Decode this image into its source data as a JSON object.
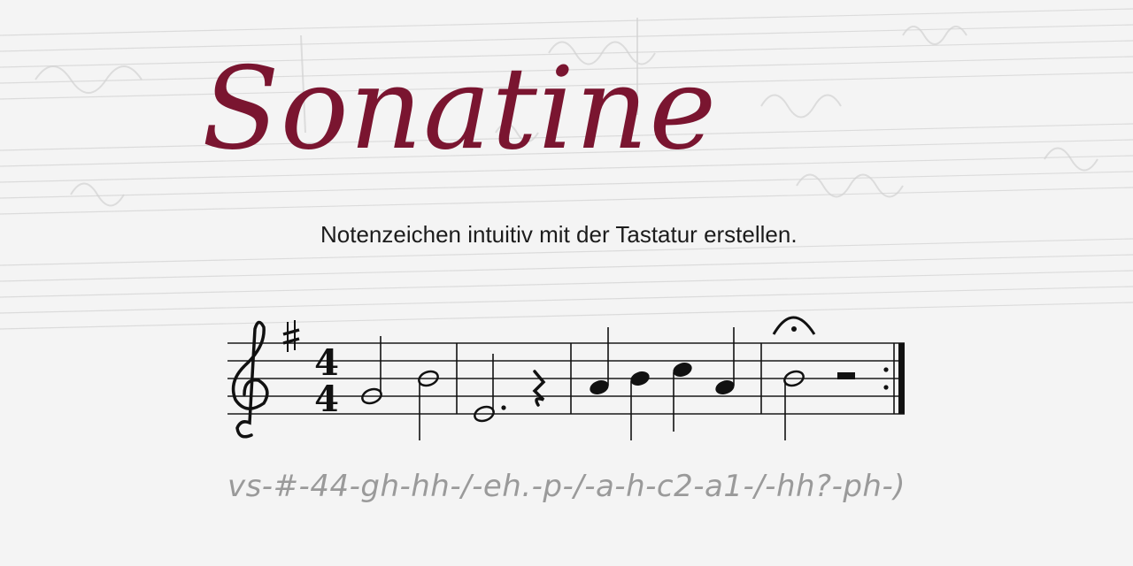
{
  "brand": {
    "title": "Sonatine",
    "title_color": "#7a1530",
    "tagline": "Notenzeichen intuitiv mit der Tastatur erstellen."
  },
  "notation": {
    "clef": "treble-clef",
    "key_signature": "#",
    "time_signature_top": "4",
    "time_signature_bottom": "4",
    "measures": [
      [
        "G half",
        "H half"
      ],
      [
        "E dotted-half",
        "quarter rest"
      ],
      [
        "A quarter",
        "H quarter",
        "C quarter",
        "A quarter"
      ],
      [
        "H half with fermata",
        "half rest"
      ]
    ],
    "ending": "repeat-barline"
  },
  "code_line": "vs-#-44-gh-hh-/-eh.-p-/-a-h-c2-a1-/-hh?-ph-)"
}
